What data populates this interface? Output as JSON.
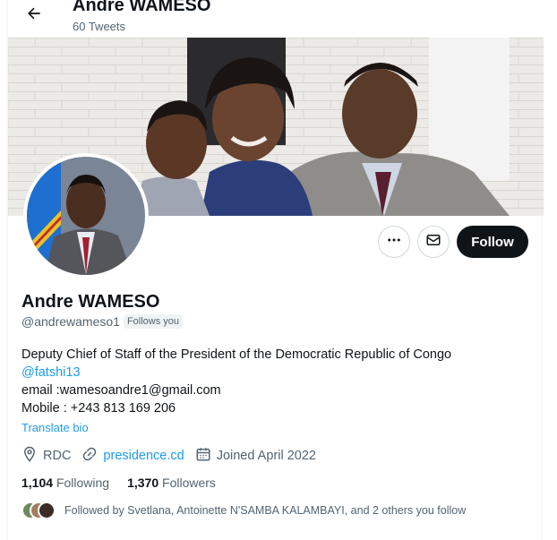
{
  "header": {
    "title": "Andre WAMESO",
    "tweet_count": "60 Tweets"
  },
  "profile": {
    "display_name": "Andre WAMESO",
    "handle": "@andrewameso1",
    "follows_you": "Follows you",
    "bio_line1": "Deputy Chief of Staff of the President of the Democratic Republic of Congo",
    "bio_mention": "@fatshi13",
    "bio_email": "email :wamesoandre1@gmail.com",
    "bio_mobile": "Mobile : +243 813 169 206",
    "translate": "Translate bio",
    "location": "RDC",
    "website": "presidence.cd",
    "joined": "Joined April 2022"
  },
  "actions": {
    "follow_label": "Follow"
  },
  "stats": {
    "following_count": "1,104",
    "following_label": "Following",
    "followers_count": "1,370",
    "followers_label": "Followers"
  },
  "followed_by": "Followed by Svetlana, Antoinette N'SAMBA KALAMBAYI, and 2 others you follow",
  "colors": {
    "accent": "#1d9bf0",
    "text": "#0f1419",
    "muted": "#536471",
    "follow_bg": "#0f1419"
  }
}
